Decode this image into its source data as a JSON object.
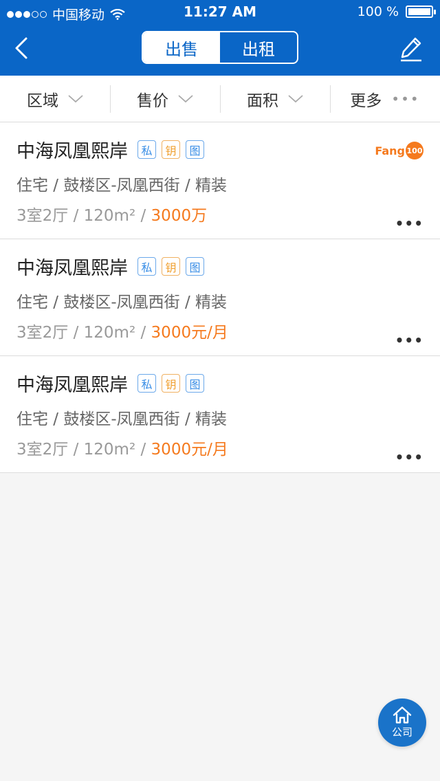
{
  "status_bar": {
    "carrier": "中国移动",
    "time": "11:27 AM",
    "battery": "100 %",
    "signal_level": 3,
    "battery_level": 1.0
  },
  "nav": {
    "tabs": [
      {
        "label": "出售",
        "active": true
      },
      {
        "label": "出租",
        "active": false
      }
    ]
  },
  "filters": [
    {
      "label": "区域"
    },
    {
      "label": "售价"
    },
    {
      "label": "面积"
    },
    {
      "label": "更多"
    }
  ],
  "listings": [
    {
      "title": "中海凤凰熙岸",
      "tags": [
        "私",
        "钥",
        "图"
      ],
      "line2": "住宅 / 鼓楼区-凤凰西街 / 精装",
      "line3_prefix": "3室2厅 / 120m² / ",
      "price": "3000万",
      "brand": "Fang",
      "brand_num": "100"
    },
    {
      "title": "中海凤凰熙岸",
      "tags": [
        "私",
        "钥",
        "图"
      ],
      "line2": "住宅 / 鼓楼区-凤凰西街 / 精装",
      "line3_prefix": "3室2厅 / 120m² / ",
      "price": "3000元/月"
    },
    {
      "title": "中海凤凰熙岸",
      "tags": [
        "私",
        "钥",
        "图"
      ],
      "line2": "住宅 / 鼓楼区-凤凰西街 / 精装",
      "line3_prefix": "3室2厅 / 120m² / ",
      "price": "3000元/月"
    }
  ],
  "fab": {
    "label": "公司",
    "icon": "home-icon"
  },
  "colors": {
    "primary": "#0a66c7",
    "price": "#f57a1e",
    "tag_blue": "#3a8ee6",
    "tag_orange": "#f0a030"
  }
}
